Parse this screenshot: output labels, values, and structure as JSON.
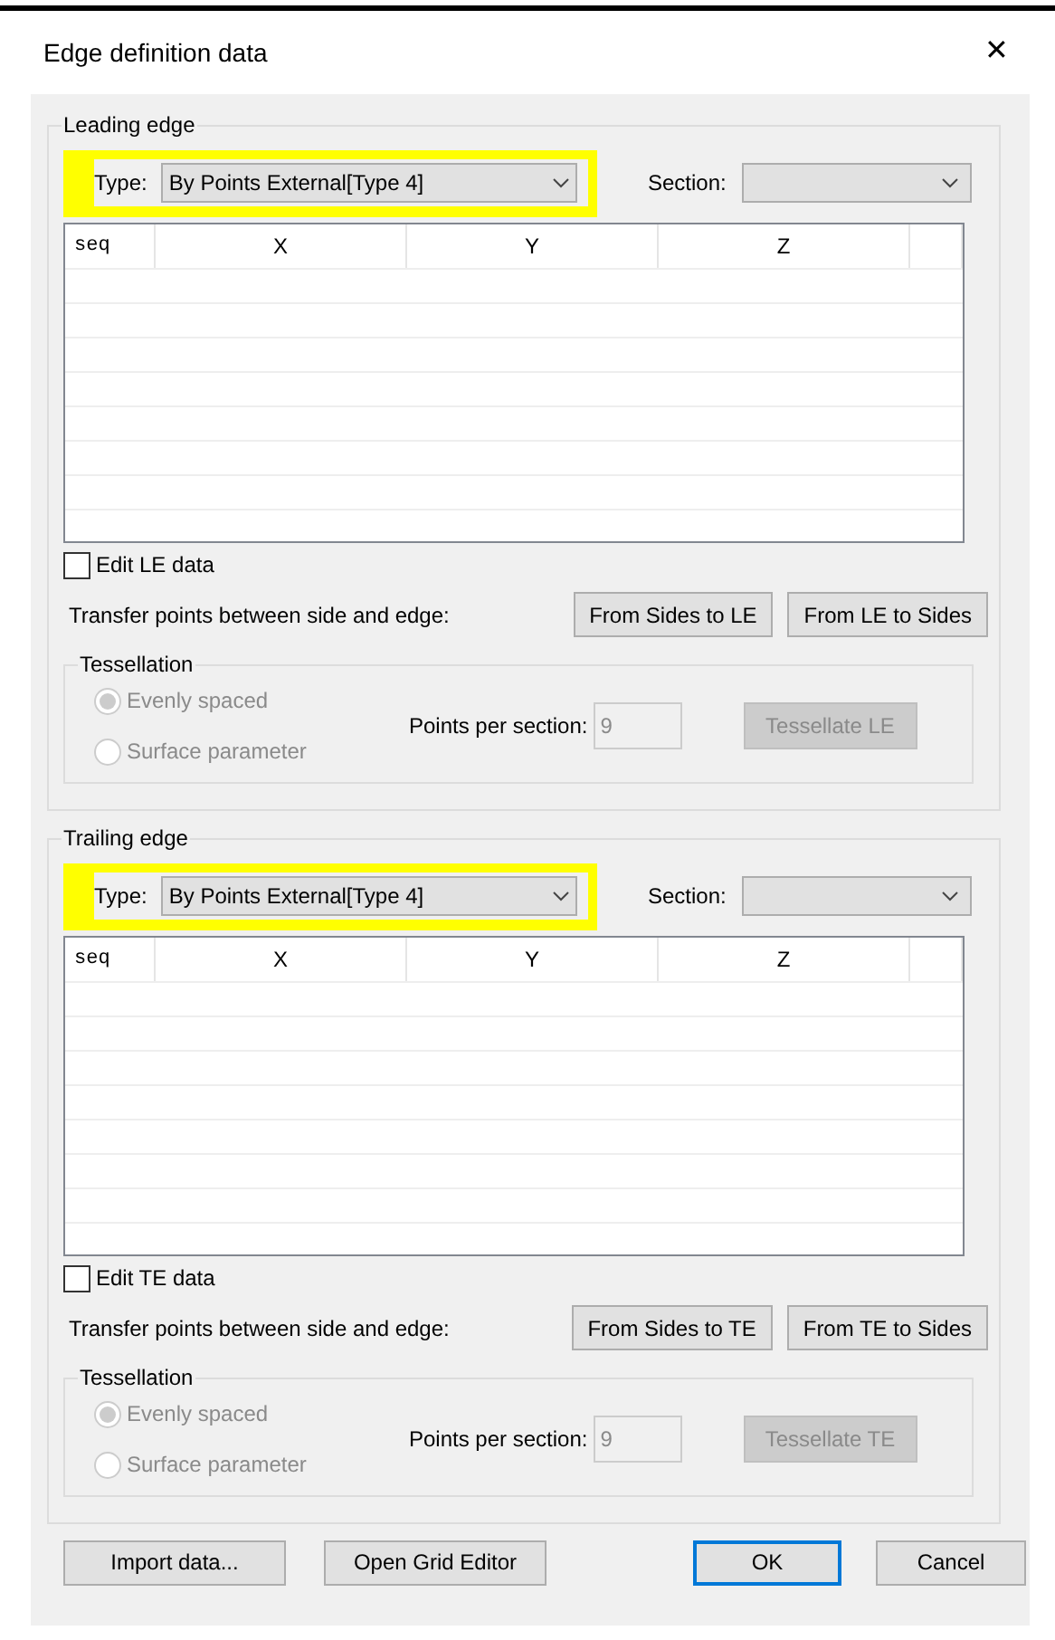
{
  "window": {
    "title": "Edge definition data",
    "close_glyph": "✕"
  },
  "sections": [
    {
      "title": "Leading edge",
      "highlighted": true,
      "type_label": "Type:",
      "type_value": "By Points External[Type 4]",
      "section_label": "Section:",
      "columns": [
        "seq",
        "X",
        "Y",
        "Z"
      ],
      "edit_checkbox": {
        "label": "Edit LE data",
        "checked": false
      },
      "transfer_label": "Transfer points between side and edge:",
      "transfer_buttons": [
        "From Sides to LE",
        "From LE to Sides"
      ],
      "tessellation": {
        "title": "Tessellation",
        "disabled": true,
        "options": [
          {
            "label": "Evenly spaced",
            "selected": true
          },
          {
            "label": "Surface parameter",
            "selected": false
          }
        ],
        "points_label": "Points per section:",
        "points_value": "9",
        "button": "Tessellate LE"
      }
    },
    {
      "title": "Trailing edge",
      "highlighted": true,
      "type_label": "Type:",
      "type_value": "By Points External[Type 4]",
      "section_label": "Section:",
      "columns": [
        "seq",
        "X",
        "Y",
        "Z"
      ],
      "edit_checkbox": {
        "label": "Edit TE data",
        "checked": false
      },
      "transfer_label": "Transfer points between side and edge:",
      "transfer_buttons": [
        "From Sides to TE",
        "From TE to Sides"
      ],
      "tessellation": {
        "title": "Tessellation",
        "disabled": true,
        "options": [
          {
            "label": "Evenly spaced",
            "selected": true
          },
          {
            "label": "Surface parameter",
            "selected": false
          }
        ],
        "points_label": "Points per section:",
        "points_value": "9",
        "button": "Tessellate TE"
      }
    }
  ],
  "buttons": [
    {
      "label": "Import data...",
      "default": false
    },
    {
      "label": "Open Grid Editor",
      "default": false
    },
    {
      "label": "OK",
      "default": true
    },
    {
      "label": "Cancel",
      "default": false
    }
  ]
}
